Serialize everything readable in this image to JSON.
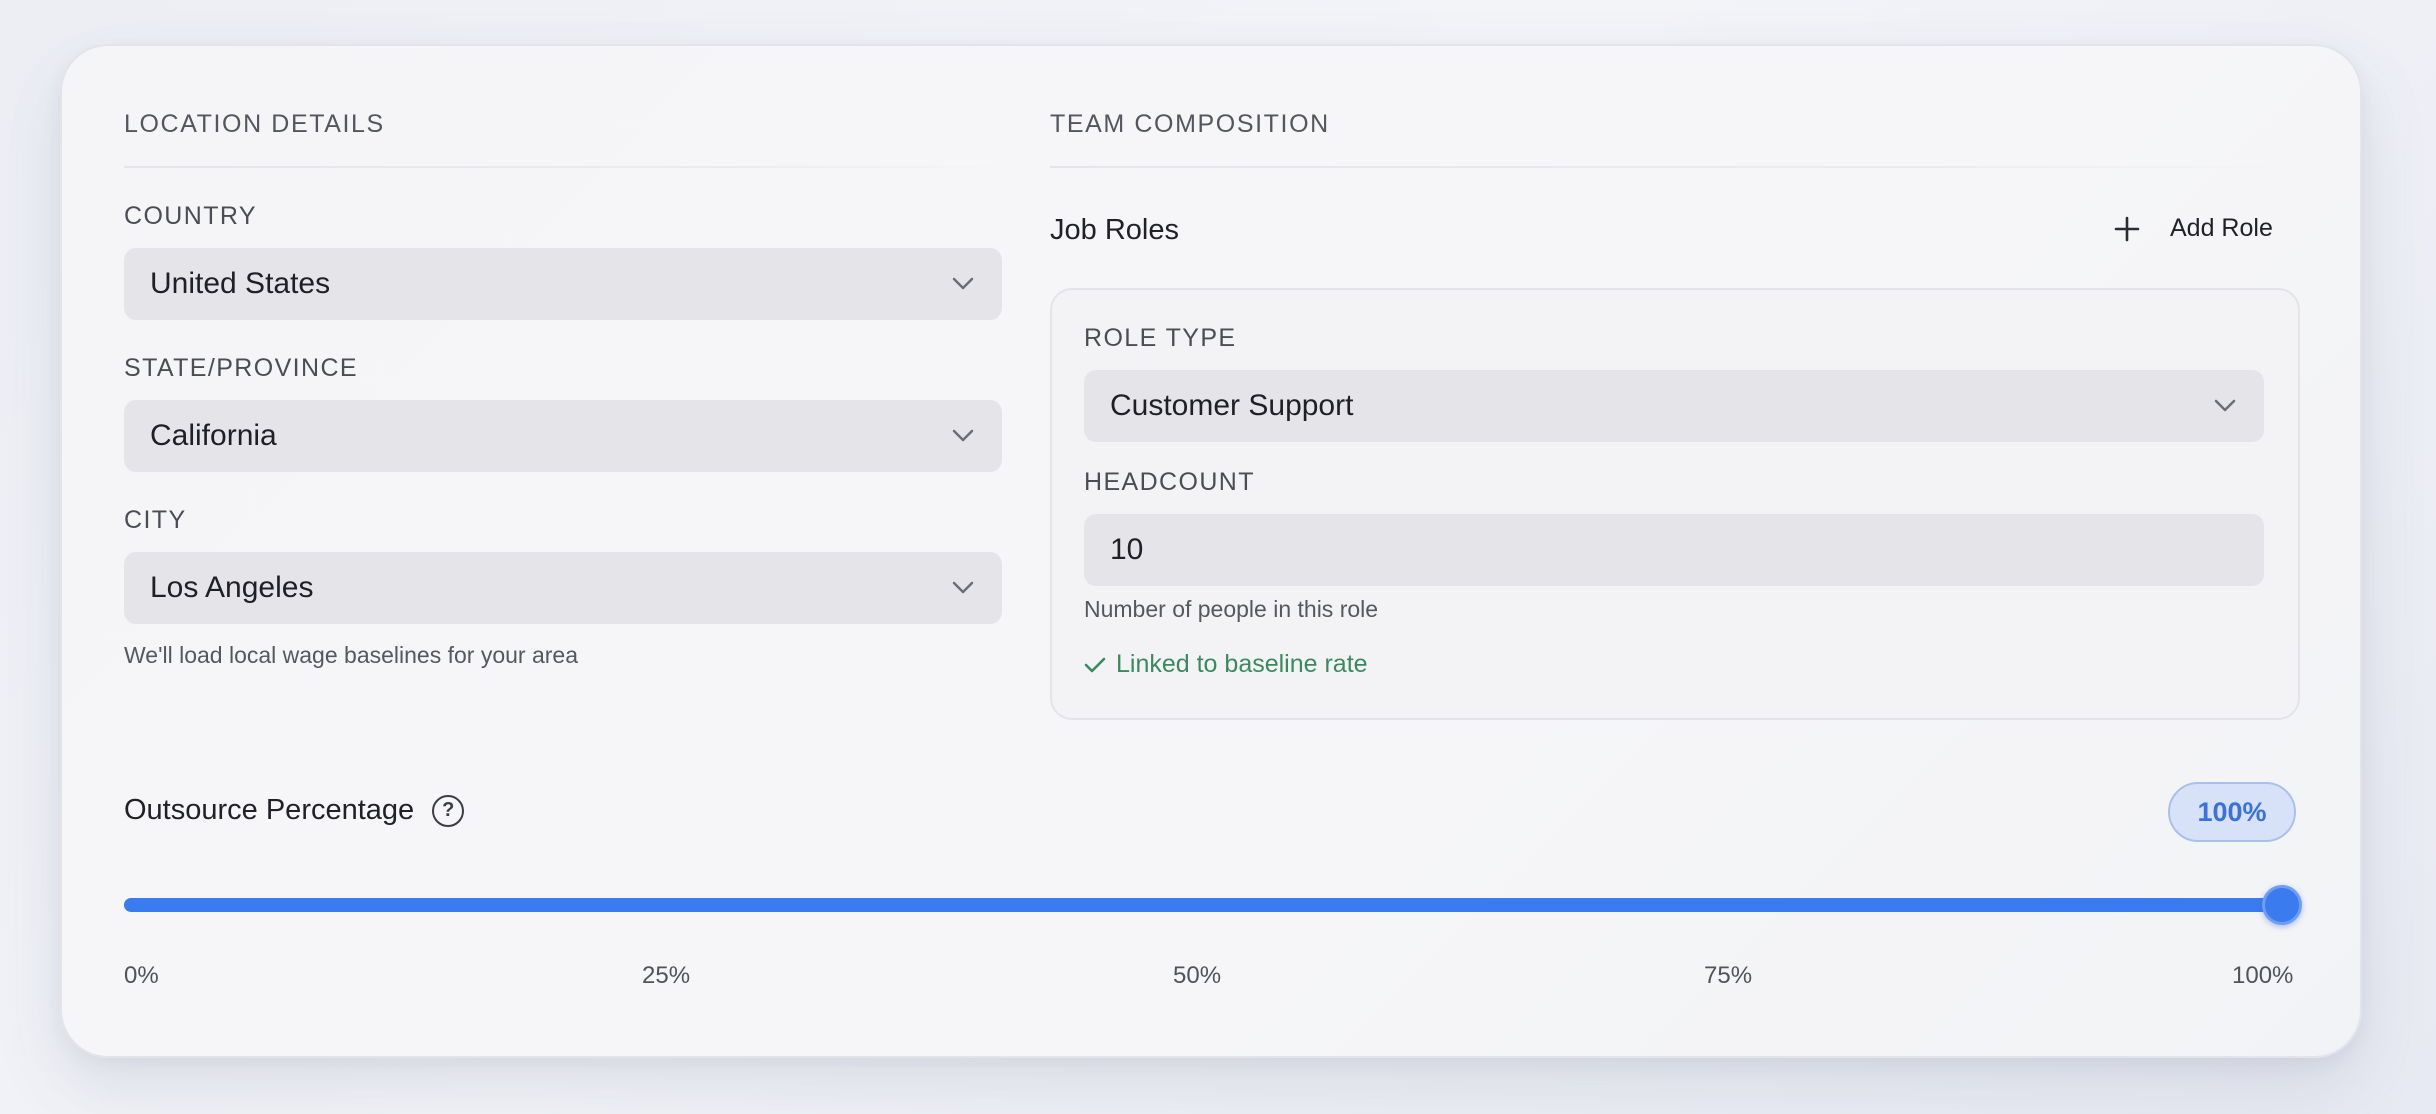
{
  "location": {
    "section_title": "LOCATION DETAILS",
    "country": {
      "label": "COUNTRY",
      "value": "United States"
    },
    "state": {
      "label": "STATE/PROVINCE",
      "value": "California"
    },
    "city": {
      "label": "CITY",
      "value": "Los Angeles"
    },
    "hint": "We'll load local wage baselines for your area"
  },
  "team": {
    "section_title": "TEAM COMPOSITION",
    "job_roles_title": "Job Roles",
    "add_role_label": "Add Role",
    "role": {
      "role_type_label": "ROLE TYPE",
      "role_type_value": "Customer Support",
      "headcount_label": "HEADCOUNT",
      "headcount_value": "10",
      "headcount_hint": "Number of people in this role",
      "linked_text": "Linked to baseline rate"
    }
  },
  "outsource": {
    "title": "Outsource Percentage",
    "help_icon": "?",
    "value_label": "100%",
    "value": 100,
    "ticks": [
      "0%",
      "25%",
      "50%",
      "75%",
      "100%"
    ]
  },
  "colors": {
    "accent": "#3b7bf0",
    "success": "#3b8a5d",
    "badge_bg": "#d7e2f8"
  },
  "icons": {
    "dropdown": "chevron-down-icon",
    "add": "plus-icon",
    "linked": "check-icon",
    "help": "question-circle-icon"
  }
}
